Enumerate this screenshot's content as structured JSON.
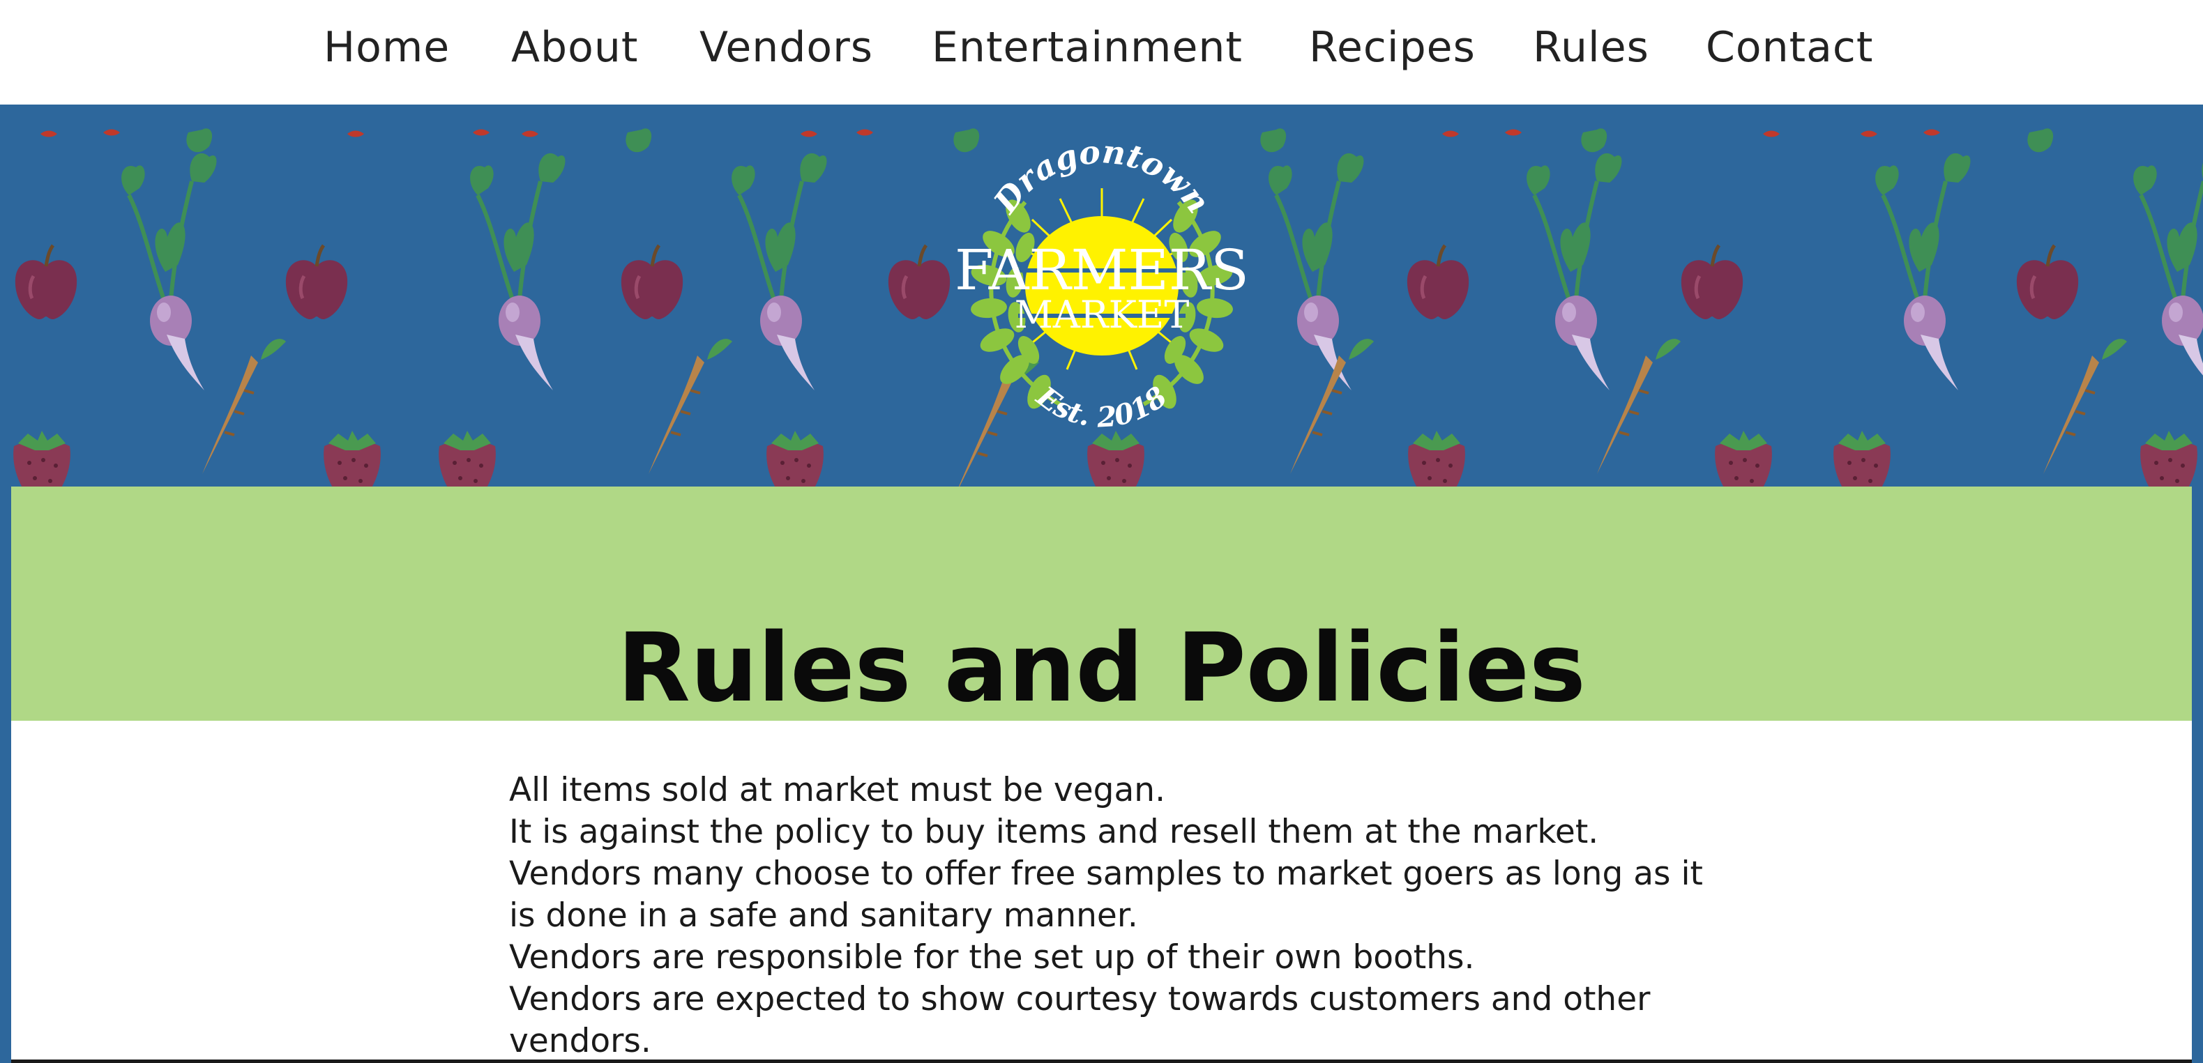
{
  "nav": {
    "items": [
      {
        "label": "Home"
      },
      {
        "label": "About"
      },
      {
        "label": "Vendors"
      },
      {
        "label": "Entertainment"
      },
      {
        "label": "Recipes"
      },
      {
        "label": "Rules"
      },
      {
        "label": "Contact"
      }
    ]
  },
  "logo": {
    "top_text": "Dragontown",
    "line1": "FARMERS",
    "line2": "MARKET",
    "established": "Est. 2018"
  },
  "header": {
    "title": "Rules and Policies"
  },
  "rules": [
    "All items sold at market must be vegan.",
    "It is against the policy to buy items and resell them at the market.",
    "Vendors many choose to offer free samples to market goers as long as it is done in a safe and sanitary manner.",
    "Vendors are responsible for the set up of their own booths.",
    "Vendors are expected to show courtesy towards customers and other vendors."
  ],
  "colors": {
    "banner_blue": "#2d679c",
    "title_green": "#b0d886",
    "logo_leaf_green": "#8cc63f",
    "logo_sun_yellow": "#fff200"
  }
}
